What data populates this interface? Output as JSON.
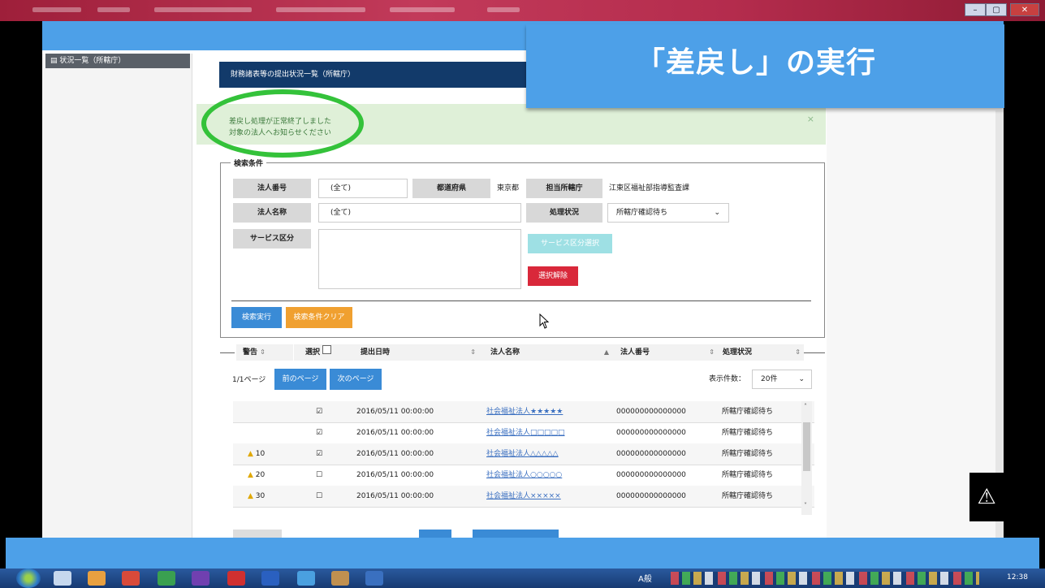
{
  "callout": {
    "title": "「差戻し」の実行"
  },
  "window": {
    "controls": [
      "–",
      "▢",
      "✕"
    ]
  },
  "sidebar": {
    "item_label": "状況一覧（所轄庁）"
  },
  "panel": {
    "header": "財務諸表等の提出状況一覧（所轄庁）"
  },
  "alert": {
    "line1": "差戻し処理が正常終了しました",
    "line2": "対象の法人へお知らせください",
    "close": "×"
  },
  "search": {
    "legend": "検索条件",
    "corp_number_label": "法人番号",
    "corp_number_value": "(全て)",
    "prefecture_label": "都道府県",
    "prefecture_value": "東京都",
    "authority_label": "担当所轄庁",
    "authority_value": "江東区福祉部指導監査課",
    "corp_name_label": "法人名称",
    "corp_name_value": "(全て)",
    "status_label": "処理状況",
    "status_value": "所轄庁確認待ち",
    "service_label": "サービス区分",
    "service_select_button": "サービス区分選択",
    "clear_selection_button": "選択解除",
    "execute_button": "検索実行",
    "reset_button": "検索条件クリア"
  },
  "list": {
    "headers": [
      "警告",
      "選択",
      "提出日時",
      "法人名称",
      "法人番号",
      "処理状況"
    ],
    "pager_text": "1/1ページ",
    "prev_button": "前のページ",
    "next_button": "次のページ",
    "count_label": "表示件数：",
    "count_value": "20件",
    "rows": [
      {
        "warning": "",
        "checked": "☑",
        "date": "2016/05/11 00:00:00",
        "name": "社会福祉法人★★★★★",
        "number": "000000000000000",
        "status": "所轄庁確認待ち"
      },
      {
        "warning": "",
        "checked": "☑",
        "date": "2016/05/11 00:00:00",
        "name": "社会福祉法人□□□□□",
        "number": "000000000000000",
        "status": "所轄庁確認待ち"
      },
      {
        "warning": "10",
        "checked": "☑",
        "date": "2016/05/11 00:00:00",
        "name": "社会福祉法人△△△△△",
        "number": "000000000000000",
        "status": "所轄庁確認待ち"
      },
      {
        "warning": "20",
        "checked": "☐",
        "date": "2016/05/11 00:00:00",
        "name": "社会福祉法人○○○○○",
        "number": "000000000000000",
        "status": "所轄庁確認待ち"
      },
      {
        "warning": "30",
        "checked": "☐",
        "date": "2016/05/11 00:00:00",
        "name": "社会福祉法人×××××",
        "number": "000000000000000",
        "status": "所轄庁確認待ち"
      }
    ]
  },
  "taskbar": {
    "tray_text": "A般",
    "clock": "12:38"
  },
  "colors": {
    "accent": "#4da0e8",
    "header": "#123a6a",
    "success_bg": "#dff0d8",
    "highlight": "#34c23a",
    "danger": "#d9283a",
    "warning": "#f0a030"
  },
  "icons": {
    "overlay": "accessibility-icon",
    "warning": "warning-triangle-icon",
    "cursor": "mouse-cursor-icon"
  }
}
